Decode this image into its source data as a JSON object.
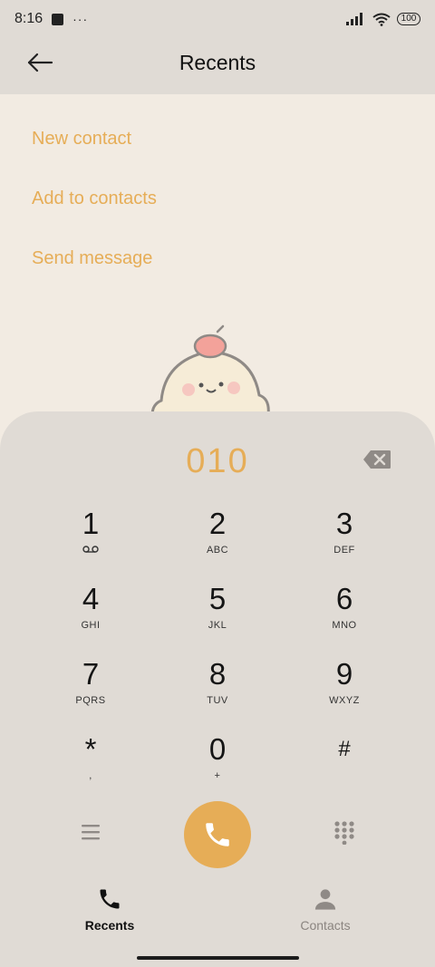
{
  "status_bar": {
    "time": "8:16",
    "more": "···",
    "battery": "100"
  },
  "header": {
    "title": "Recents"
  },
  "actions": [
    {
      "label": "New contact"
    },
    {
      "label": "Add to contacts"
    },
    {
      "label": "Send message"
    }
  ],
  "dialer": {
    "number": "010",
    "keys": [
      {
        "digit": "1",
        "letters": ""
      },
      {
        "digit": "2",
        "letters": "ABC"
      },
      {
        "digit": "3",
        "letters": "DEF"
      },
      {
        "digit": "4",
        "letters": "GHI"
      },
      {
        "digit": "5",
        "letters": "JKL"
      },
      {
        "digit": "6",
        "letters": "MNO"
      },
      {
        "digit": "7",
        "letters": "PQRS"
      },
      {
        "digit": "8",
        "letters": "TUV"
      },
      {
        "digit": "9",
        "letters": "WXYZ"
      },
      {
        "digit": "*",
        "letters": ","
      },
      {
        "digit": "0",
        "letters": "+"
      },
      {
        "digit": "#",
        "letters": ""
      }
    ]
  },
  "tabs": [
    {
      "label": "Recents",
      "icon": "phone-icon",
      "active": true
    },
    {
      "label": "Contacts",
      "icon": "person-icon",
      "active": false
    }
  ],
  "colors": {
    "accent": "#e6ad57",
    "panel": "#e0dbd5",
    "background": "#f2ebe2"
  }
}
